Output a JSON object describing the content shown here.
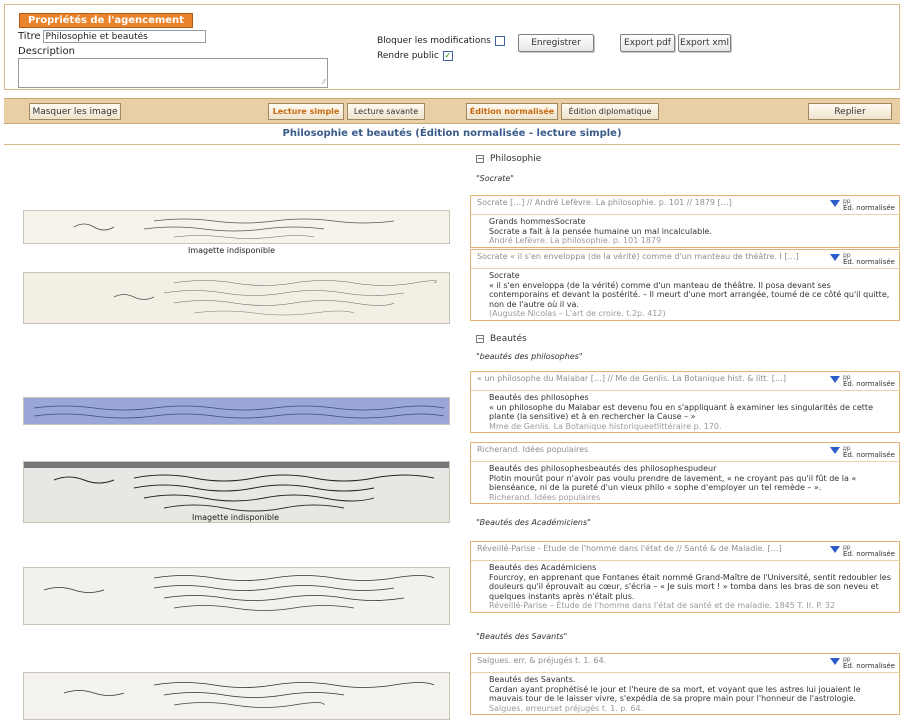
{
  "props": {
    "legend": "Propriétés de l'agencement",
    "title_label": "Titre",
    "title_value": "Philosophie et beautés",
    "description_label": "Description",
    "lock_label": "Bloquer les modifications",
    "public_label": "Rendre public",
    "public_checked": "✓",
    "save_label": "Enregistrer",
    "export_pdf_label": "Export pdf",
    "export_xml_label": "Export xml"
  },
  "toolbar": {
    "hide_images": "Masquer les image",
    "simple_reading": "Lecture simple",
    "learned_reading": "Lecture savante",
    "normalized_edition": "Édition normalisée",
    "diplomatic_edition": "Édition diplomatique",
    "collapse": "Replier"
  },
  "heading": "Philosophie et beautés (Édition normalisée - lecture simple)",
  "image_captions": {
    "unavailable_1": "Imagette indisponible",
    "unavailable_2": "Imagette indisponible"
  },
  "sections": {
    "philosophie": "Philosophie",
    "beautes": "Beautés"
  },
  "quote_labels": {
    "socrate": "\"Socrate\"",
    "beautes_philosophes": "\"beautés des philosophes\"",
    "beautes_academiciens": "\"Beautés des Académiciens\"",
    "beautes_savants": "\"Beautés des Savants\""
  },
  "card_ctl": {
    "pp": "pp",
    "ed": "Éd. normalisée"
  },
  "cards": [
    {
      "head": "Socrate […] // André Lefèvre. La philosophie. p. 101 // 1879 […]",
      "body": [
        "Grands hommesSocrate",
        "Socrate a fait à la pensée humaine un mal incalculable."
      ],
      "src": "André Lefèvre. La philosophie. p. 101 1879"
    },
    {
      "head": "Socrate « il s'en enveloppa (de la vérité) comme d'un manteau de théâtre. I […]",
      "body": [
        "Socrate",
        "« il s'en enveloppa (de la vérité) comme d'un manteau de théâtre. Il posa devant ses contemporains et devant la postérité. – Il meurt d'une mort arrangée, toumé de ce côté qu'il quitte, non de l'autre où il va."
      ],
      "src": "(Auguste Nicolas – L'art de croire. t.2p. 412)"
    },
    {
      "head": "« un philosophe du Malabar […] // Me de Genlis. La Botanique hist. & litt. […]",
      "body": [
        "Beautés des philosophes",
        "« un philosophe du Malabar est devenu fou en s'appliquant à examiner les singularités de cette plante (la sensitive) et à en rechercher la Cause – »"
      ],
      "src": "Mme de Genlis. La Botanique historiqueetlittéraire p. 170."
    },
    {
      "head": "Richerand. Idées populaires",
      "body": [
        "Beautés des philosophesbeautés des philosophespudeur",
        "Plotin mourût pour n'avoir pas voulu prendre de lavement, « ne croyant pas qu'il fût de la « bienséance, ni de la pureté d'un vieux philo « sophe d'employer un tel remède – »."
      ],
      "src": "Richerand. Idées populaires"
    },
    {
      "head": "Réveillé-Parise - Étude de l'homme dans l'état de // Santé & de Maladie. […]",
      "body": [
        "Beautés des Académiciens",
        "Fourcroy, en apprenant que Fontanes était nommé Grand-Maître de l'Université, sentit redoubler les douleurs qu'il éprouvait au cœur, s'écria – « Je suis mort ! » tomba dans les bras de son neveu et quelques instants après n'était plus."
      ],
      "src": "Réveillé-Parise – Étude de l'homme dans l'état de santé et de maladie. 1845 T. II. P. 32"
    },
    {
      "head": "Salgues. err. & préjugés t. 1. 64.",
      "body": [
        "Beautés des Savants.",
        "Cardan ayant prophétisé le jour et l'heure de sa mort, et voyant que les astres lui jouaient le mauvais tour de le laisser vivre, s'expédia de sa propre main pour l'honneur de l'astrologie."
      ],
      "src": "Salgues. erreurset préjugés t. 1. p. 64."
    }
  ]
}
